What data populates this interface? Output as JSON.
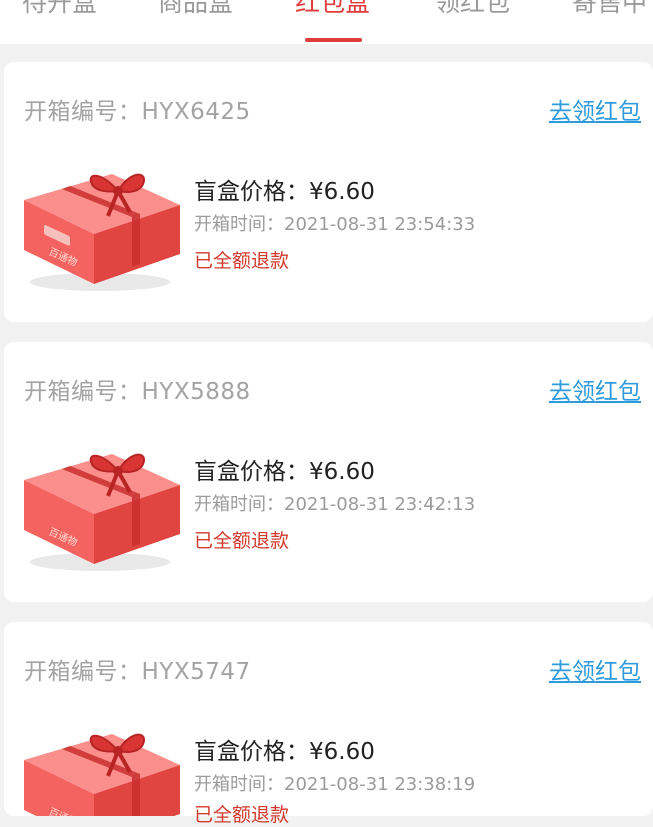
{
  "tabs": [
    {
      "label": "待开盒"
    },
    {
      "label": "商品盒"
    },
    {
      "label": "红包盒",
      "active": true
    },
    {
      "label": "领红包"
    },
    {
      "label": "寄售中"
    }
  ],
  "colors": {
    "accent": "#e03b3b",
    "link": "#2f9bdc",
    "refund_text": "#d23a2c",
    "box": "#f2605f"
  },
  "box_icon": "gift-box-icon",
  "box_brand": "百通物",
  "orders": [
    {
      "order_no": "开箱编号：HYX6425",
      "claim_label": "去领红包",
      "price": "盲盒价格：¥6.60",
      "open_time": "开箱时间：2021-08-31 23:54:33",
      "status": "已全额退款"
    },
    {
      "order_no": "开箱编号：HYX5888",
      "claim_label": "去领红包",
      "price": "盲盒价格：¥6.60",
      "open_time": "开箱时间：2021-08-31 23:42:13",
      "status": "已全额退款"
    },
    {
      "order_no": "开箱编号：HYX5747",
      "claim_label": "去领红包",
      "price": "盲盒价格：¥6.60",
      "open_time": "开箱时间：2021-08-31 23:38:19",
      "status": "已全额退款"
    }
  ]
}
